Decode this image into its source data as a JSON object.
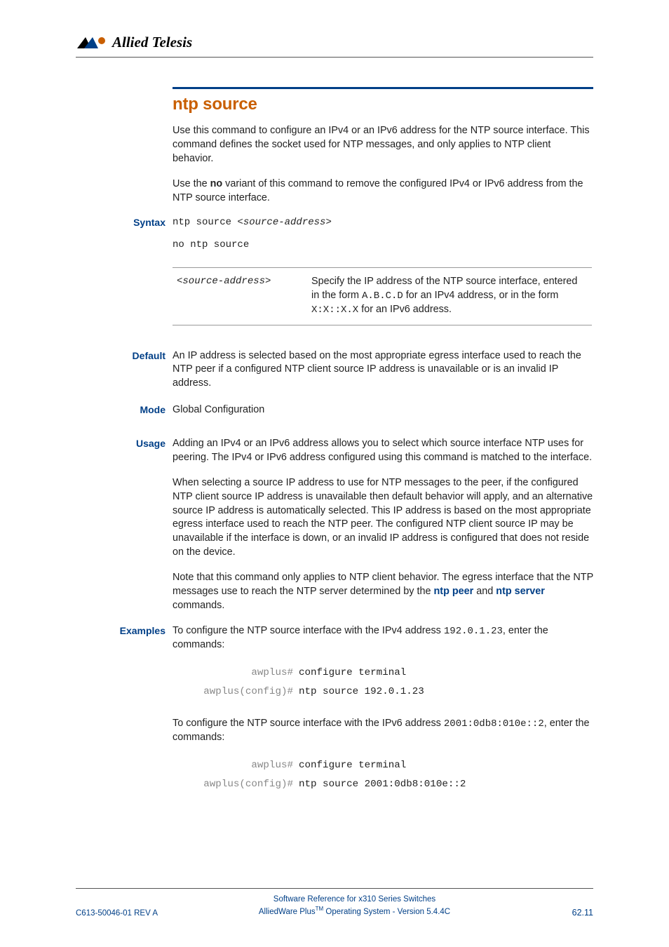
{
  "header": {
    "brand": "Allied Telesis"
  },
  "title": "ntp source",
  "intro1_pre": "Use this command to configure an IPv4 or an IPv6 address for the NTP source interface. This command defines the socket used for NTP messages, and only applies to NTP client behavior.",
  "intro2_pre": "Use the ",
  "intro2_bold": "no",
  "intro2_post": " variant of this command to remove the configured IPv4 or IPv6 address from the NTP source interface.",
  "labels": {
    "syntax": "Syntax",
    "default": "Default",
    "mode": "Mode",
    "usage": "Usage",
    "examples": "Examples"
  },
  "syntax": {
    "line1_cmd": "ntp source ",
    "line1_param": "<source-address>",
    "line2": "no ntp source"
  },
  "param_table": {
    "row1": {
      "name": "<source-address>",
      "desc_pre": "Specify the IP address of the NTP source interface, entered in the form ",
      "desc_code1": "A.B.C.D",
      "desc_mid1": " for an IPv4 address, or in the form ",
      "desc_code2": "X:X::X.X",
      "desc_post": " for an IPv6 address."
    }
  },
  "default_text": "An IP address is selected based on the most appropriate egress interface used to reach the NTP peer if a configured NTP client source IP address is unavailable or is an invalid IP address.",
  "mode_text": "Global Configuration",
  "usage": {
    "p1": "Adding an IPv4 or an IPv6 address allows you to select which source interface NTP uses for peering. The IPv4 or IPv6 address configured using this command is matched to the interface.",
    "p2": "When selecting a source IP address to use for NTP messages to the peer, if the configured NTP client source IP address is unavailable then default behavior will apply, and an alternative source IP address is automatically selected. This IP address is based on the most appropriate egress interface used to reach the NTP peer. The configured NTP client source IP may be unavailable if the interface is down, or an invalid IP address is configured that does not reside on the device.",
    "p3_pre": "Note that this command only applies to NTP client behavior. The egress interface that the NTP messages use to reach the NTP server determined by the ",
    "p3_link1": "ntp peer",
    "p3_mid": " and ",
    "p3_link2": "ntp server",
    "p3_post": " commands."
  },
  "examples": {
    "intro1_pre": "To configure the NTP source interface with the IPv4 address ",
    "intro1_code": "192.0.1.23",
    "intro1_post": ", enter the commands:",
    "cli1": {
      "r1_prompt": "awplus#",
      "r1_cmd": "configure terminal",
      "r2_prompt": "awplus(config)#",
      "r2_cmd": "ntp source 192.0.1.23"
    },
    "intro2_pre": "To configure the NTP source interface with the IPv6 address ",
    "intro2_code": "2001:0db8:010e::2",
    "intro2_post": ", enter the commands:",
    "cli2": {
      "r1_prompt": "awplus#",
      "r1_cmd": "configure terminal",
      "r2_prompt": "awplus(config)#",
      "r2_cmd": "ntp source 2001:0db8:010e::2"
    }
  },
  "footer": {
    "left": "C613-50046-01 REV A",
    "center_line1": "Software Reference for x310 Series Switches",
    "center_line2_pre": "AlliedWare Plus",
    "center_line2_sup": "TM",
    "center_line2_post": " Operating System - Version 5.4.4C",
    "right": "62.11"
  }
}
